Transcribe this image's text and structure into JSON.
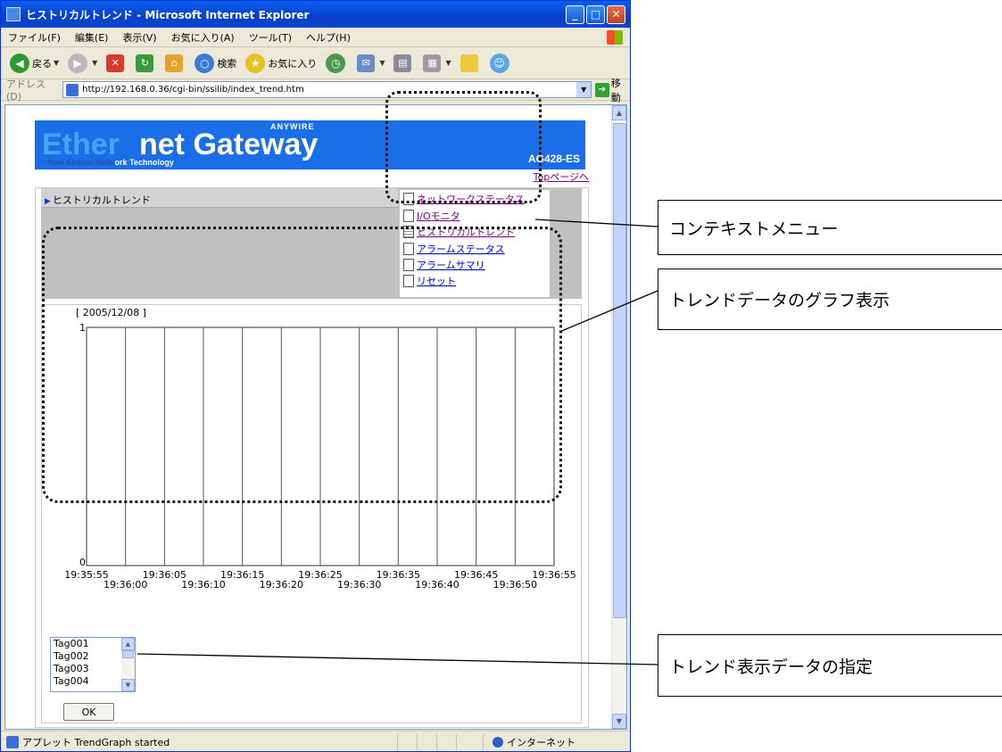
{
  "window": {
    "title": "ヒストリカルトレンド - Microsoft Internet Explorer",
    "menu": [
      "ファイル(F)",
      "編集(E)",
      "表示(V)",
      "お気に入り(A)",
      "ツール(T)",
      "ヘルプ(H)"
    ],
    "toolbar": {
      "back": "戻る",
      "search": "検索",
      "favorites": "お気に入り"
    },
    "address_label": "アドレス(D)",
    "address_url": "http://192.168.0.36/cgi-bin/ssilib/index_trend.htm",
    "go_label": "移動",
    "status_text": "アプレット TrendGraph started",
    "zone_text": "インターネット"
  },
  "page": {
    "banner": {
      "part1": "Ether",
      "part2": "net Gateway",
      "brand": "ANYWIRE",
      "tagline_a": "New Sensor Netw",
      "tagline_b": "ork Technology",
      "model": "AG428-ES"
    },
    "top_link": "Topページへ",
    "breadcrumb": "ヒストリカルトレンド",
    "context_menu": [
      {
        "label": "ネットワークステータス",
        "visited": true
      },
      {
        "label": "I/Oモニタ",
        "visited": true
      },
      {
        "label": "ヒストリカルトレンド",
        "visited": true
      },
      {
        "label": "アラームステータス",
        "visited": false
      },
      {
        "label": "アラームサマリ",
        "visited": false
      },
      {
        "label": "リセット",
        "visited": false
      }
    ],
    "tag_list": [
      "Tag001",
      "Tag002",
      "Tag003",
      "Tag004"
    ],
    "ok_label": "OK"
  },
  "chart_data": {
    "type": "line",
    "title": "[ 2005/12/08 ]",
    "y_max_label": "1",
    "y_min_label": "0",
    "ylim": [
      0,
      1
    ],
    "x_ticks_top": [
      "19:35:55",
      "19:36:05",
      "19:36:15",
      "19:36:25",
      "19:36:35",
      "19:36:45",
      "19:36:55"
    ],
    "x_ticks_bottom": [
      "19:36:00",
      "19:36:10",
      "19:36:20",
      "19:36:30",
      "19:36:40",
      "19:36:50"
    ],
    "grid": true,
    "series": []
  },
  "callouts": {
    "context_menu": "コンテキストメニュー",
    "graph": "トレンドデータのグラフ表示",
    "selector": "トレンド表示データの指定"
  },
  "colors": {
    "banner_blue": "#1a6ee8",
    "visited_link": "#800080",
    "link": "#0000cc"
  }
}
